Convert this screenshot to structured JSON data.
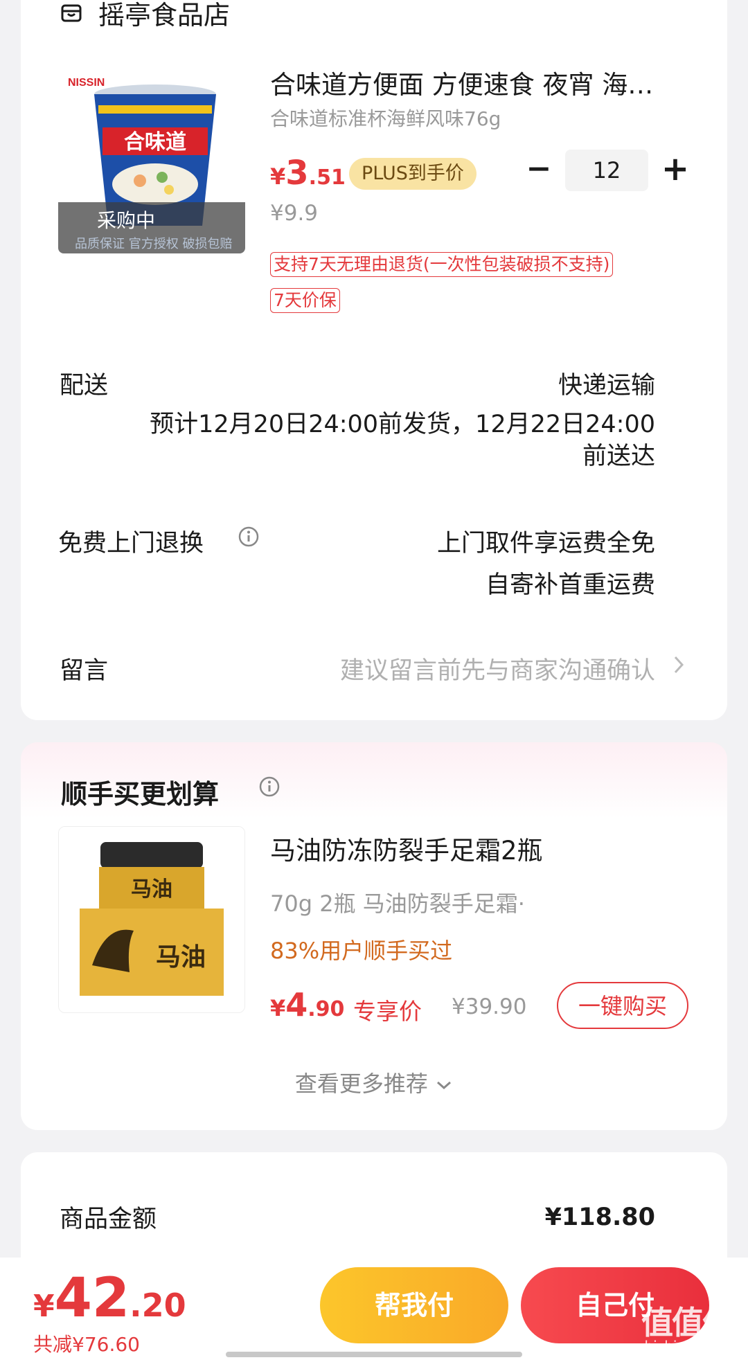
{
  "shop": {
    "name": "摇亭食品店",
    "icon": "store-icon"
  },
  "product": {
    "title": "合味道方便面 方便速食 夜宵 海鲜风味",
    "spec": "合味道标准杯海鲜风味76g",
    "price_symbol": "¥",
    "price_int": "3",
    "price_dec": ".51",
    "plus_tag": "PLUS到手价",
    "original_price": "¥9.9",
    "quantity": "12",
    "minus_label": "−",
    "plus_label": "+",
    "image_overlay": "采购中",
    "tags": [
      "支持7天无理由退货(一次性包装破损不支持)",
      "7天价保"
    ]
  },
  "delivery": {
    "label": "配送",
    "method": "快递运输",
    "line1": "预计12月20日24:00前发货，12月22日24:00",
    "line2": "前送达"
  },
  "returns": {
    "label": "免费上门退换",
    "line1": "上门取件享运费全免",
    "line2": "自寄补首重运费"
  },
  "message": {
    "label": "留言",
    "placeholder": "建议留言前先与商家沟通确认"
  },
  "recommend": {
    "section_title": "顺手买更划算",
    "title": "马油防冻防裂手足霜2瓶",
    "spec": "70g 2瓶 马油防裂手足霜·",
    "buyers": "83%用户顺手买过",
    "price_symbol": "¥",
    "price_int": "4",
    "price_dec": ".90",
    "exclusive_label": "专享价",
    "original_price": "¥39.90",
    "buy_label": "一键购买",
    "more_label": "查看更多推荐"
  },
  "summary": {
    "amount_label": "商品金额",
    "amount_value": "¥118.80"
  },
  "footer": {
    "total_symbol": "¥",
    "total_int": "42",
    "total_dec": ".20",
    "saved": "共减¥76.60",
    "help_pay": "帮我付",
    "self_pay": "自己付",
    "watermark": "值值值",
    "watermark_url": "zhizhizhi.com"
  },
  "colors": {
    "accent_red": "#e4393c",
    "plus_gold": "#f9e3a3",
    "help_btn": "#fcc62b",
    "self_btn": "#f74a4f"
  }
}
